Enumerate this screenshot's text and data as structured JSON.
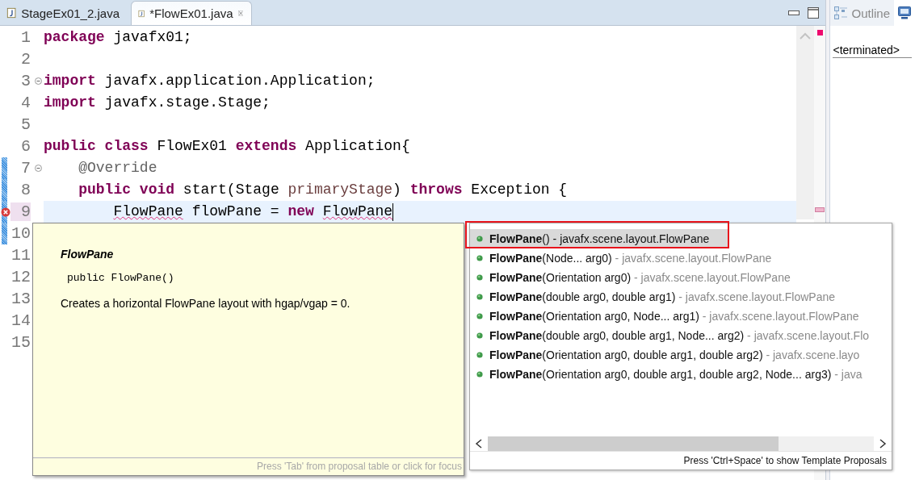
{
  "editor_tabs": [
    {
      "label": "StageEx01_2.java",
      "selected": false,
      "closable": false
    },
    {
      "label": "*FlowEx01.java",
      "selected": true,
      "closable": true
    }
  ],
  "code_lines": [
    {
      "number": "1",
      "tokens": [
        {
          "text": "package",
          "kind": "keyword"
        },
        {
          "text": " javafx01;",
          "kind": "plain"
        }
      ]
    },
    {
      "number": "2"
    },
    {
      "number": "3",
      "fold": true,
      "tokens": [
        {
          "text": "import",
          "kind": "keyword"
        },
        {
          "text": " javafx.application.Application;",
          "kind": "plain"
        }
      ]
    },
    {
      "number": "4",
      "tokens": [
        {
          "text": "import",
          "kind": "keyword"
        },
        {
          "text": " javafx.stage.Stage;",
          "kind": "plain"
        }
      ]
    },
    {
      "number": "5"
    },
    {
      "number": "6",
      "tokens": [
        {
          "text": "public class",
          "kind": "keyword"
        },
        {
          "text": " FlowEx01 ",
          "kind": "plain"
        },
        {
          "text": "extends",
          "kind": "keyword"
        },
        {
          "text": " Application{",
          "kind": "plain"
        }
      ]
    },
    {
      "number": "7",
      "fold": true,
      "changed": true,
      "tokens": [
        {
          "text": "    @Override",
          "kind": "annotation"
        }
      ]
    },
    {
      "number": "8",
      "changed": true,
      "tokens": [
        {
          "text": "    public void",
          "kind": "keyword"
        },
        {
          "text": " start(Stage ",
          "kind": "plain"
        },
        {
          "text": "primaryStage",
          "kind": "variable"
        },
        {
          "text": ") ",
          "kind": "plain"
        },
        {
          "text": "throws",
          "kind": "keyword"
        },
        {
          "text": " Exception {",
          "kind": "plain"
        }
      ]
    },
    {
      "number": "9",
      "changed": true,
      "current": true,
      "error": true,
      "tokens": [
        {
          "text": "        FlowPane",
          "kind": "error"
        },
        {
          "text": " flowPane = ",
          "kind": "plain"
        },
        {
          "text": "new ",
          "kind": "keyword"
        },
        {
          "text": "FlowPane",
          "kind": "error"
        }
      ]
    },
    {
      "number": "10",
      "changed": true
    },
    {
      "number": "11"
    },
    {
      "number": "12"
    },
    {
      "number": "13"
    },
    {
      "number": "14"
    },
    {
      "number": "15"
    }
  ],
  "side_panel": {
    "tabs": [
      {
        "label": "Outline",
        "kind": "outline",
        "selected": false
      },
      {
        "kind": "console",
        "selected": true
      }
    ],
    "status_label": "<terminated>"
  },
  "info_popup": {
    "title": "FlowPane",
    "signature": "public FlowPane()",
    "description": "Creates a horizontal FlowPane layout with hgap/vgap = 0.",
    "footer": "Press 'Tab' from proposal table or click for focus"
  },
  "proposals": {
    "items": [
      {
        "name": "FlowPane",
        "params": "()",
        "detail": " - javafx.scene.layout.FlowPane",
        "selected": true
      },
      {
        "name": "FlowPane",
        "params": "(Node... arg0)",
        "detail": " - javafx.scene.layout.FlowPane",
        "selected": false
      },
      {
        "name": "FlowPane",
        "params": "(Orientation arg0)",
        "detail": " - javafx.scene.layout.FlowPane",
        "selected": false
      },
      {
        "name": "FlowPane",
        "params": "(double arg0, double arg1)",
        "detail": " - javafx.scene.layout.FlowPane",
        "selected": false
      },
      {
        "name": "FlowPane",
        "params": "(Orientation arg0, Node... arg1)",
        "detail": " - javafx.scene.layout.FlowPane",
        "selected": false
      },
      {
        "name": "FlowPane",
        "params": "(double arg0, double arg1, Node... arg2)",
        "detail": " - javafx.scene.layout.Flo",
        "selected": false
      },
      {
        "name": "FlowPane",
        "params": "(Orientation arg0, double arg1, double arg2)",
        "detail": " - javafx.scene.layo",
        "selected": false
      },
      {
        "name": "FlowPane",
        "params": "(Orientation arg0, double arg1, double arg2, Node... arg3)",
        "detail": " - java",
        "selected": false
      }
    ],
    "footer": "Press 'Ctrl+Space' to show Template Proposals"
  }
}
